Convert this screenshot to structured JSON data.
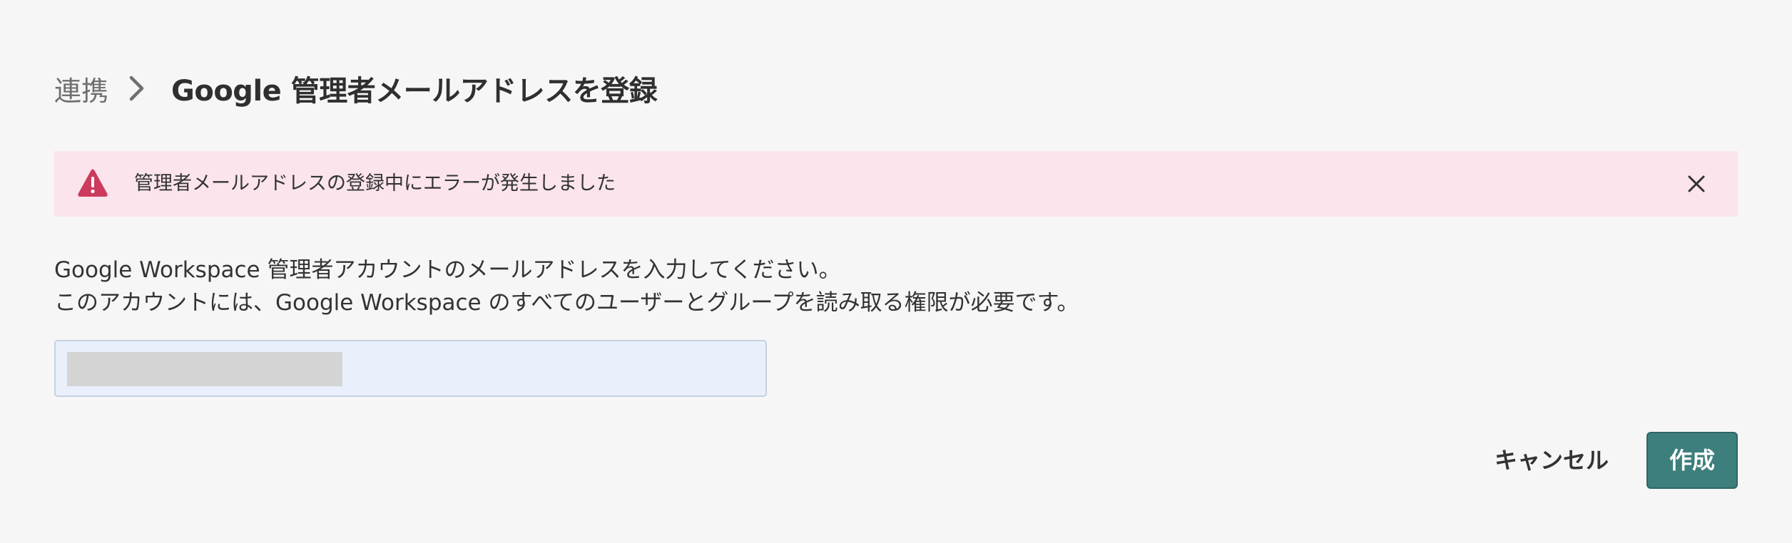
{
  "breadcrumb": {
    "parent": "連携",
    "title": "Google 管理者メールアドレスを登録"
  },
  "alert": {
    "message": "管理者メールアドレスの登録中にエラーが発生しました",
    "icon": "warning-icon",
    "close_icon": "close-icon",
    "color": "#fbe4ec",
    "icon_color": "#cc3b5d"
  },
  "description": {
    "line1": "Google Workspace 管理者アカウントのメールアドレスを入力してください。",
    "line2": "このアカウントには、Google Workspace のすべてのユーザーとグループを読み取る権限が必要です。"
  },
  "email_field": {
    "value": "",
    "redacted": true
  },
  "actions": {
    "cancel_label": "キャンセル",
    "create_label": "作成",
    "primary_color": "#3d7f7d"
  }
}
